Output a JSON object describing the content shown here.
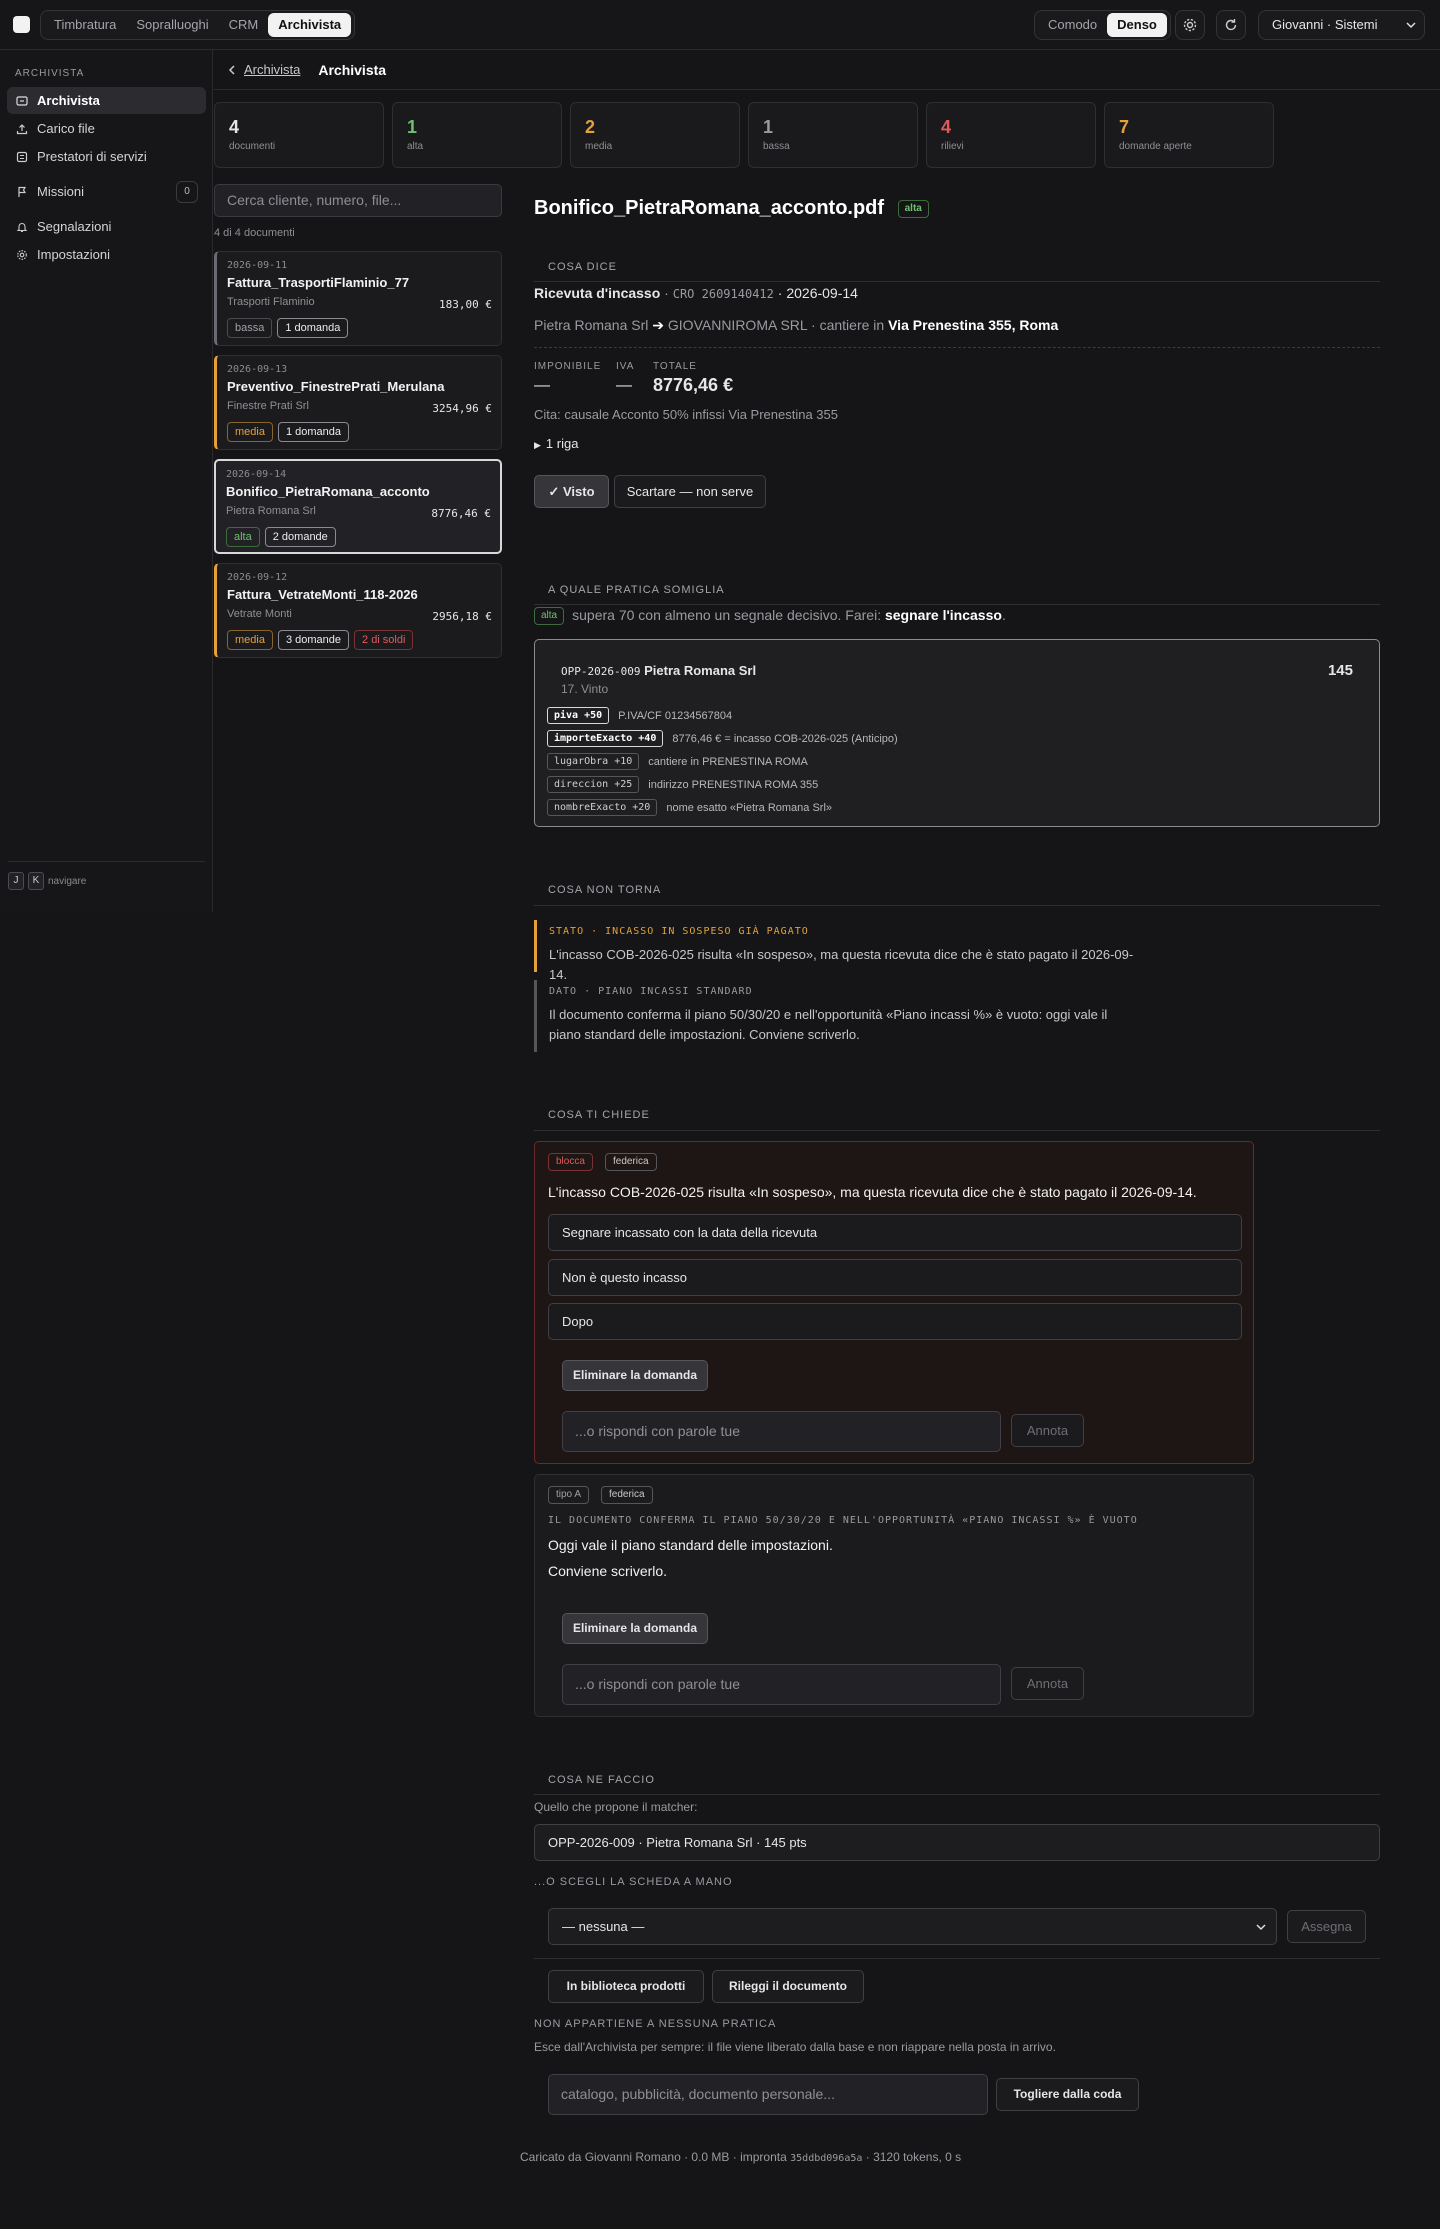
{
  "topnav": {
    "tabs": [
      "Timbratura",
      "Sopralluoghi",
      "CRM",
      "Archivista"
    ],
    "density": [
      "Comodo",
      "Denso"
    ],
    "user": "Giovanni · Sistemi"
  },
  "sidebar": {
    "heading": "ARCHIVISTA",
    "items": [
      {
        "label": "Archivista",
        "icon": "archive-icon"
      },
      {
        "label": "Carico file",
        "icon": "upload-icon"
      },
      {
        "label": "Prestatori di servizi",
        "icon": "list-icon"
      },
      {
        "label": "Missioni",
        "icon": "flag-icon",
        "count": "0"
      },
      {
        "label": "Segnalazioni",
        "icon": "bell-icon"
      },
      {
        "label": "Impostazioni",
        "icon": "gear-icon"
      }
    ],
    "footer": {
      "key1": "J",
      "key2": "K",
      "label": "navigare"
    }
  },
  "breadcrumb": {
    "back": "Archivista",
    "current": "Archivista"
  },
  "stats": [
    {
      "num": "4",
      "label": "documenti",
      "color": "#f2f2f2"
    },
    {
      "num": "1",
      "label": "alta",
      "color": "#6fc06f"
    },
    {
      "num": "2",
      "label": "media",
      "color": "#e3a13b"
    },
    {
      "num": "1",
      "label": "bassa",
      "color": "#9a9aa0"
    },
    {
      "num": "4",
      "label": "rilievi",
      "color": "#e05a5a"
    },
    {
      "num": "7",
      "label": "domande aperte",
      "color": "#e3a13b"
    }
  ],
  "list": {
    "search_placeholder": "Cerca cliente, numero, file...",
    "count": "4 di 4 documenti",
    "docs": [
      {
        "date": "2026-09-11",
        "name": "Fattura_TrasportiFlaminio_77",
        "who": "Trasporti Flaminio",
        "amount": "183,00 €",
        "tags": [
          "bassa",
          "1 domanda"
        ],
        "accent": "#6a6a70"
      },
      {
        "date": "2026-09-13",
        "name": "Preventivo_FinestrePrati_Merulana",
        "who": "Finestre Prati Srl",
        "amount": "3254,96 €",
        "tags": [
          "media",
          "1 domanda"
        ],
        "accent": "#e3a13b"
      },
      {
        "date": "2026-09-14",
        "name": "Bonifico_PietraRomana_acconto",
        "who": "Pietra Romana Srl",
        "amount": "8776,46 €",
        "tags": [
          "alta",
          "2 domande"
        ],
        "accent": "#6fc06f"
      },
      {
        "date": "2026-09-12",
        "name": "Fattura_VetrateMonti_118-2026",
        "who": "Vetrate Monti",
        "amount": "2956,18 €",
        "tags": [
          "media",
          "3 domande",
          "2 di soldi"
        ],
        "accent": "#e3a13b"
      }
    ]
  },
  "doc": {
    "title": "Bonifico_PietraRomana_acconto.pdf",
    "badge": "alta",
    "says": {
      "heading": "COSA DICE",
      "kind": "Ricevuta d'incasso",
      "sep": " · ",
      "code": "CRO 2609140412",
      "date": "· 2026-09-14",
      "from": "Pietra Romana Srl",
      "arrow": "➔",
      "to": "GIOVANNIROMA SRL · cantiere in",
      "site": "Via Prenestina 355, Roma",
      "imponibile_label": "IMPONIBILE",
      "imponibile": "—",
      "iva_label": "IVA",
      "iva": "—",
      "totale_label": "TOTALE",
      "totale": "8776,46 €",
      "cita": "Cita: causale Acconto 50% infissi Via Prenestina 355",
      "rows": "1 riga",
      "seen_btn": "✓ Visto",
      "discard_btn": "Scartare — non serve"
    },
    "match": {
      "heading": "A QUALE PRATICA SOMIGLIA",
      "badge": "alta",
      "text": "supera 70 con almeno un segnale decisivo. Farei:",
      "action": "segnare l'incasso",
      "dot": ".",
      "code": "OPP-2026-009",
      "client": "Pietra Romana Srl",
      "stage": "17. Vinto",
      "score": "145",
      "signals": [
        {
          "tag": "piva +50",
          "text": "P.IVA/CF 01234567804",
          "strong": true
        },
        {
          "tag": "importeExacto +40",
          "text": "8776,46 € = incasso COB-2026-025 (Anticipo)",
          "strong": true
        },
        {
          "tag": "lugarObra +10",
          "text": "cantiere in PRENESTINA ROMA",
          "strong": false
        },
        {
          "tag": "direccion +25",
          "text": "indirizzo PRENESTINA ROMA 355",
          "strong": false
        },
        {
          "tag": "nombreExacto +20",
          "text": "nome esatto «Pietra Romana Srl»",
          "strong": false
        }
      ]
    },
    "issues": {
      "heading": "COSA NON TORNA",
      "items": [
        {
          "key": "STATO · INCASSO IN SOSPESO GIÀ PAGATO",
          "text": "L'incasso COB-2026-025 risulta «In sospeso», ma questa ricevuta dice che è stato pagato il 2026-09-14.",
          "color": "#e3a13b"
        },
        {
          "key": "DATO · PIANO INCASSI STANDARD",
          "text": "Il documento conferma il piano 50/30/20 e nell'opportunità «Piano incassi %» è vuoto: oggi vale il piano standard delle impostazioni. Conviene scriverlo.",
          "color": "#9a9aa0"
        }
      ]
    },
    "questions": {
      "heading": "COSA TI CHIEDE",
      "q1": {
        "tag1": "blocca",
        "tag2": "federica",
        "text": "L'incasso COB-2026-025 risulta «In sospeso», ma questa ricevuta dice che è stato pagato il 2026-09-14.",
        "options": [
          "Segnare incassato con la data della ricevuta",
          "Non è questo incasso",
          "Dopo"
        ],
        "delete": "Eliminare la domanda",
        "placeholder": "...o rispondi con parole tue",
        "annota": "Annota"
      },
      "q2": {
        "tag1": "tipo A",
        "tag2": "federica",
        "caps": "IL DOCUMENTO CONFERMA IL PIANO 50/30/20 E NELL'OPPORTUNITÀ «PIANO INCASSI %» È VUOTO",
        "line1": "Oggi vale il piano standard delle impostazioni.",
        "line2": "Conviene scriverlo.",
        "delete": "Eliminare la domanda",
        "placeholder": "...o rispondi con parole tue",
        "annota": "Annota"
      }
    },
    "todo": {
      "heading": "COSA NE FACCIO",
      "proposal_label": "Quello che propone il matcher:",
      "proposal": "OPP-2026-009 · Pietra Romana Srl · 145 pts",
      "manual_label": "...O SCEGLI LA SCHEDA A MANO",
      "select": "— nessuna —",
      "assign": "Assegna",
      "lib_btn": "In biblioteca prodotti",
      "reread_btn": "Rileggi il documento",
      "none_label": "NON APPARTIENE A NESSUNA PRATICA",
      "none_text": "Esce dall'Archivista per sempre: il file viene liberato dalla base e non riappare nella posta in arrivo.",
      "none_placeholder": "catalogo, pubblicità, documento personale...",
      "remove_btn": "Togliere dalla coda"
    },
    "footer": {
      "text1": "Caricato da Giovanni Romano · 0.0 MB · impronta",
      "hash": "35ddbd096a5a",
      "text2": "· 3120 tokens, 0 s"
    }
  }
}
